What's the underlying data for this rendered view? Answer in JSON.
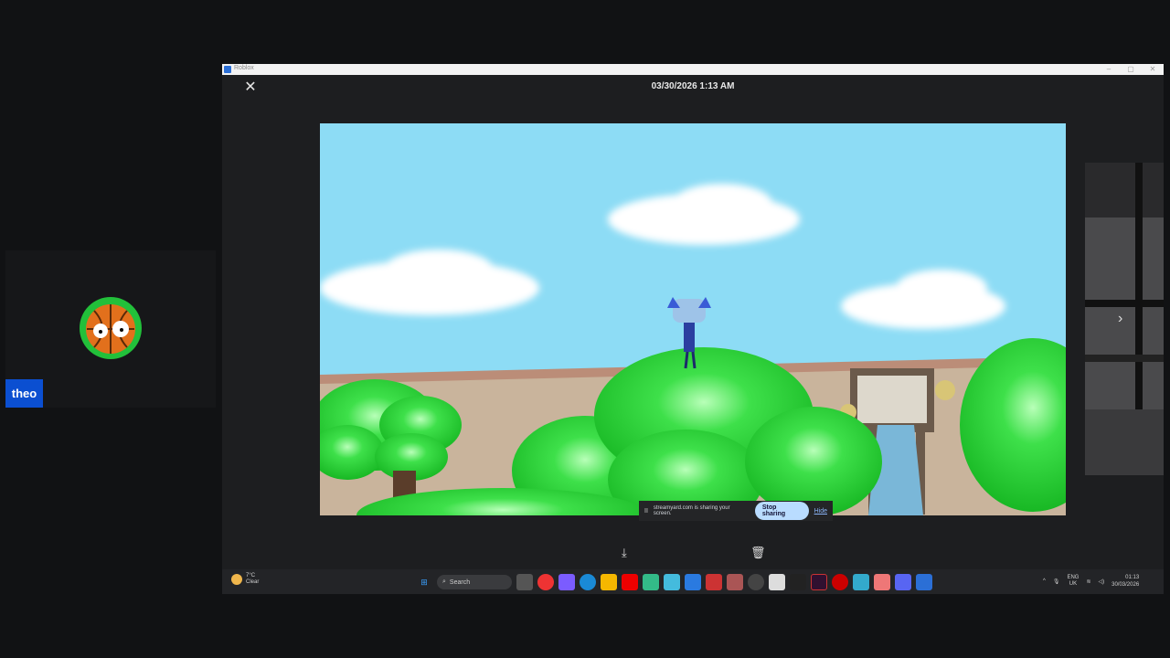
{
  "participant": {
    "name": "theo",
    "avatar_icon": "basketball-avatar"
  },
  "window": {
    "title": "Roblox",
    "controls": {
      "minimize": "–",
      "maximize": "▢",
      "close": "✕"
    }
  },
  "viewer": {
    "close_icon": "✕",
    "date": "03/30/2026 1:13 AM",
    "next_icon": "›",
    "download_icon": "⤓",
    "delete_icon": "🗑"
  },
  "share_notice": {
    "text": "streamyard.com is sharing your screen.",
    "stop_label": "Stop sharing",
    "hide_label": "Hide",
    "pause_icon": "II"
  },
  "taskbar": {
    "weather": {
      "temp": "7°C",
      "condition": "Clear"
    },
    "search_placeholder": "Search",
    "tray": {
      "lang_line1": "ENG",
      "lang_line2": "UK",
      "time": "01:13",
      "date": "30/03/2026"
    }
  },
  "colors": {
    "sky": "#8ddcf5",
    "grass": "#22d630",
    "accent": "#0b4fd1",
    "stop_button": "#b9dcff"
  }
}
